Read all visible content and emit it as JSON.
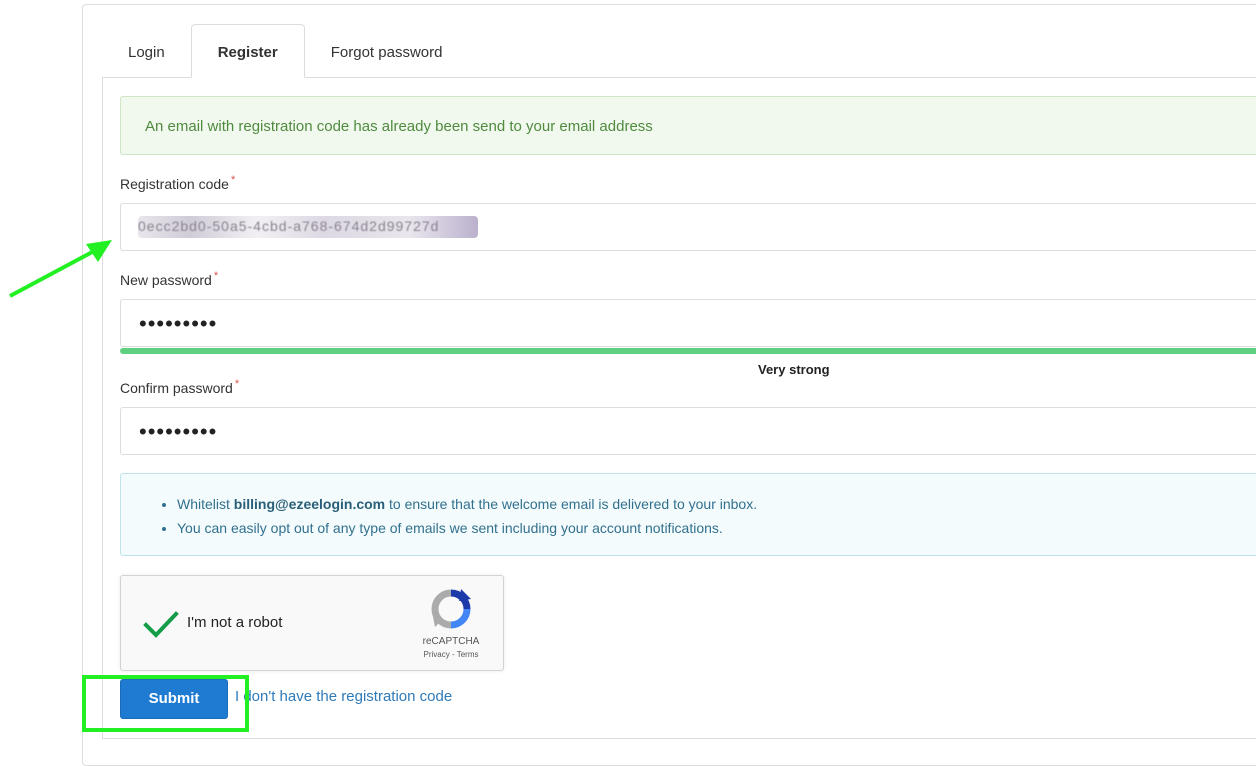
{
  "tabs": [
    {
      "label": "Login",
      "active": false
    },
    {
      "label": "Register",
      "active": true
    },
    {
      "label": "Forgot password",
      "active": false
    }
  ],
  "alert_success": {
    "text": "An email with registration code has already been send to your email address"
  },
  "registration_code": {
    "label": "Registration code",
    "required_mark": "*",
    "value": "0ecc2bd0-50a5-4cbd-a768-674d2d99727d"
  },
  "new_password": {
    "label": "New password",
    "required_mark": "*",
    "value": "•••••••••"
  },
  "strength": {
    "text": "Very strong",
    "level": 1.0,
    "color": "#5fcf80"
  },
  "confirm_password": {
    "label": "Confirm password",
    "required_mark": "*",
    "value": "•••••••••"
  },
  "info": {
    "item1_prefix": "Whitelist ",
    "item1_email": "billing@ezeelogin.com",
    "item1_suffix": " to ensure that the welcome email is delivered to your inbox.",
    "item2": "You can easily opt out of any type of emails we sent including your account notifications."
  },
  "recaptcha": {
    "label": "I'm not a robot",
    "brand": "reCAPTCHA",
    "terms": "Privacy - Terms",
    "checked": true
  },
  "submit": {
    "label": "Submit"
  },
  "no_code_link": {
    "text": "I don't have the registration code"
  },
  "colors": {
    "accent": "#1f7bd1",
    "highlight": "#22f022",
    "success_text": "#4f8a3f",
    "info_text": "#31708f"
  }
}
